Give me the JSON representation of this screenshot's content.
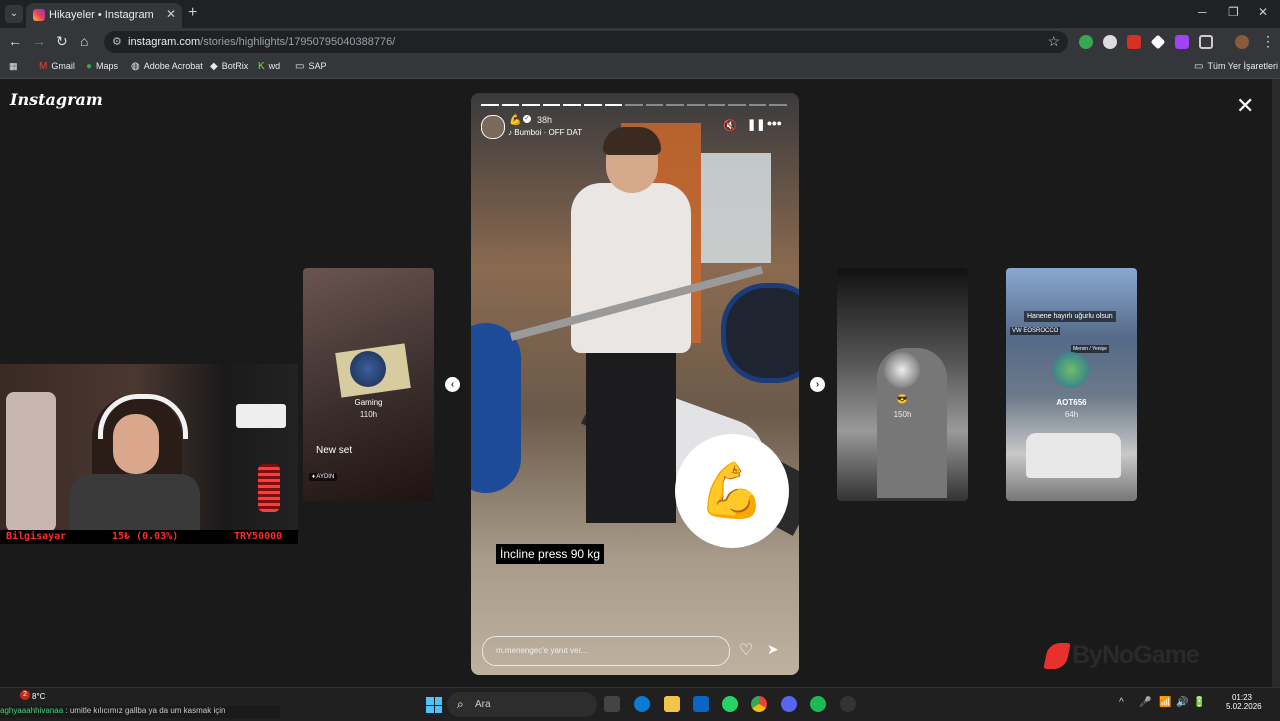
{
  "browser": {
    "tab": {
      "title": "Hikayeler • Instagram",
      "close": "✕"
    },
    "new_tab": "+",
    "menu_icon": "⌄",
    "window": {
      "minimize": "─",
      "restore": "❐",
      "close": "✕"
    },
    "nav": {
      "back": "←",
      "forward": "→",
      "reload": "↻",
      "home": "⌂"
    },
    "url": {
      "host": "instagram.com",
      "path": "/stories/highlights/17950795040388776/"
    },
    "url_icon": "⚙",
    "star": "☆",
    "more": "⋮",
    "bookmarks": [
      "Gmail",
      "Maps",
      "Adobe Acrobat",
      "BotRix",
      "wd",
      "SAP"
    ],
    "all_bookmarks": "Tüm Yer İşaretleri"
  },
  "page": {
    "logo": "Instagram",
    "close": "✕"
  },
  "story": {
    "progress_total": 15,
    "progress_done": 7,
    "emoji": "💪",
    "verified": "✓",
    "time": "38h",
    "music": "Bumboi · OFF DAT",
    "mute": "🔇",
    "pause": "❚❚",
    "more": "•••",
    "sticker": "💪",
    "caption": "İncline press 90 kg",
    "reply_placeholder": "m.menengec'e yanıt ver...",
    "heart": "♡",
    "send": "➤"
  },
  "arrows": {
    "prev": "‹",
    "next": "›"
  },
  "side_stories": [
    {
      "label": "Gaming",
      "time": "110h",
      "text": "New set",
      "tag": "♦ AYDIN"
    },
    {
      "label": "",
      "time": "150h",
      "emoji": "😎"
    },
    {
      "label": "AOT656",
      "time": "64h",
      "text1": "Hanene hayırlı uğurlu olsun",
      "text2": "VW EOSROCCO",
      "text3": "Mersin / Yenişe"
    }
  ],
  "stream": {
    "left": "Bilgisayar",
    "mid": "15₺ (0.03%)",
    "right": "TRY50000"
  },
  "watermark": "ByNoGame",
  "taskbar": {
    "weather": "8°C",
    "badge": "2",
    "ticker_user": "aghyaaahhivanaa",
    "ticker_text": " : umitle kılıcımız gallba ya da um kasmak için",
    "search": "Ara",
    "time": "01:23",
    "date": "5.02.2026",
    "tray": [
      "^",
      "🎤",
      "📶",
      "🔊",
      "🔋"
    ]
  }
}
